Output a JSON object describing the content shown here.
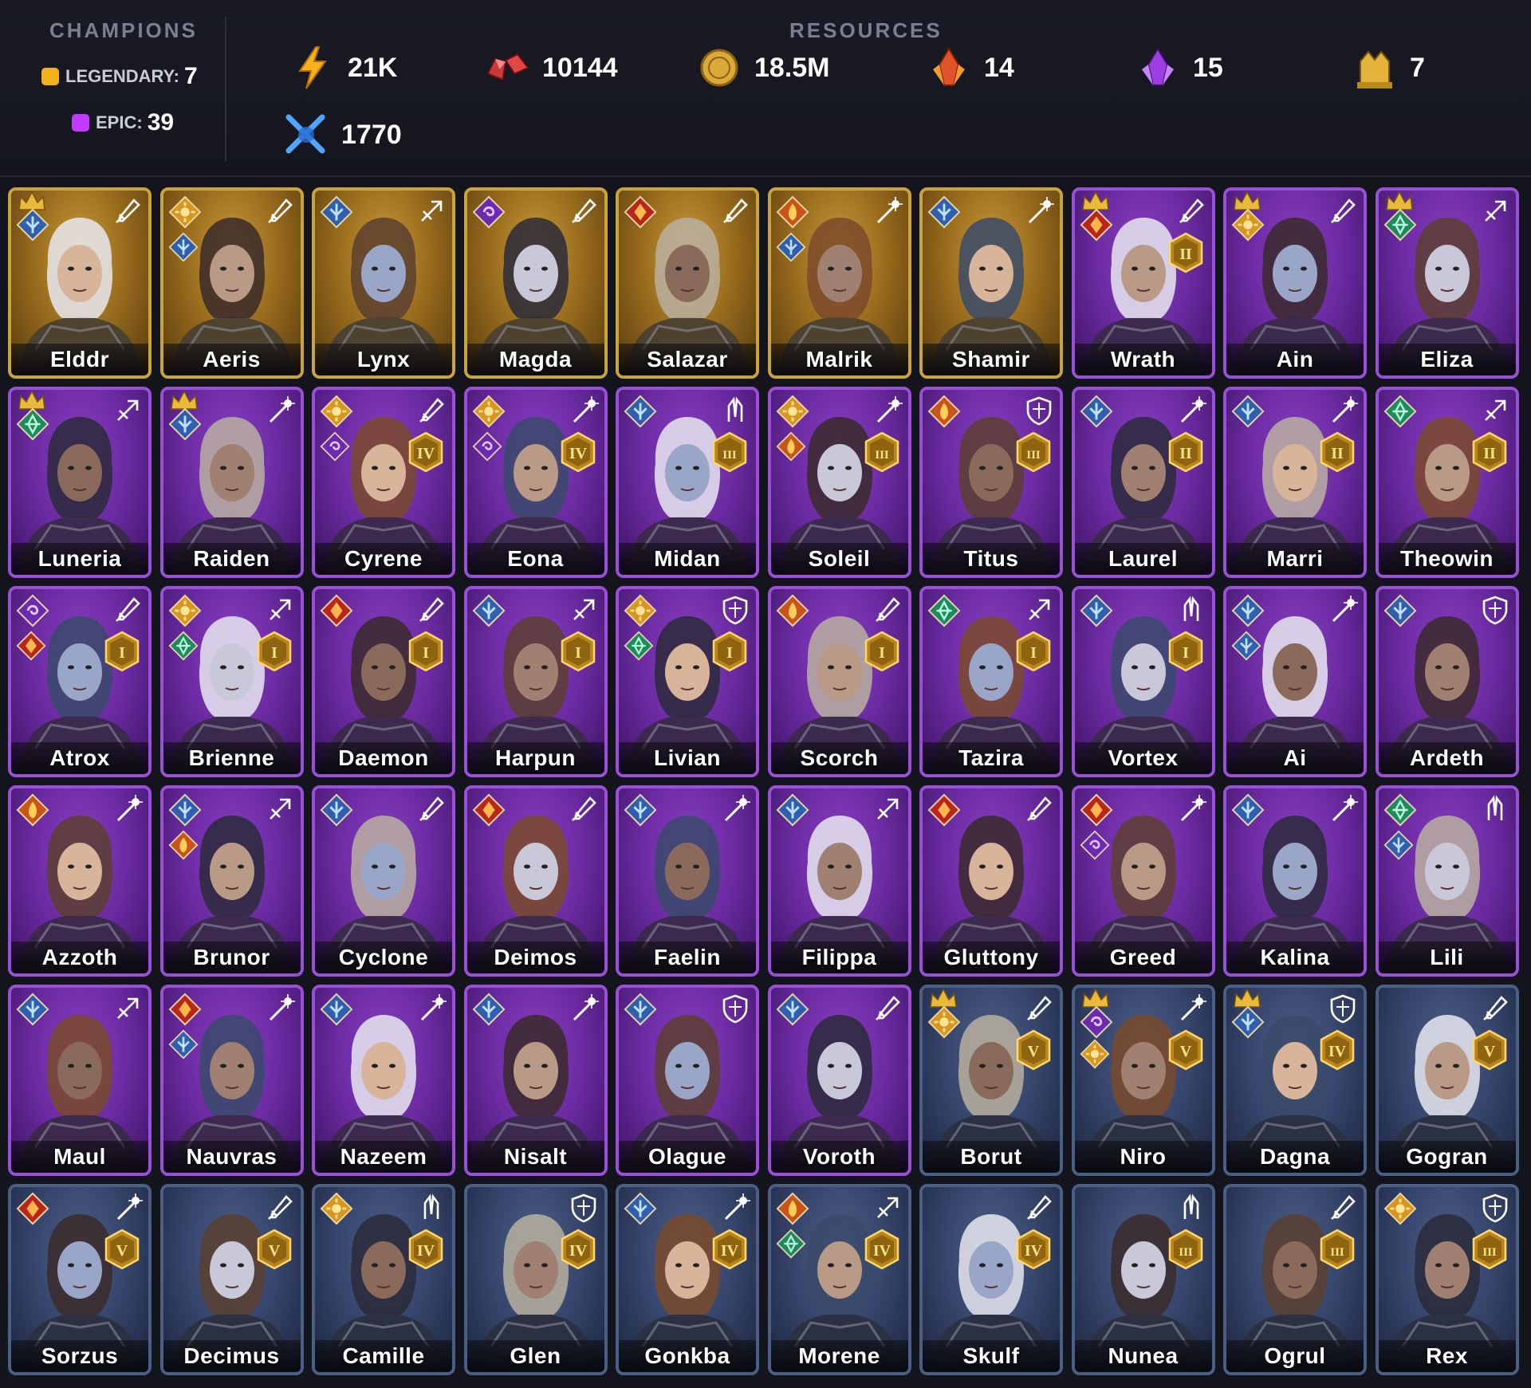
{
  "header": {
    "champions_title": "CHAMPIONS",
    "resources_title": "RESOURCES",
    "legendary_label": "LEGENDARY:",
    "legendary_count": "7",
    "epic_label": "EPIC:",
    "epic_count": "39",
    "resources": [
      {
        "name": "energy-icon",
        "value": "21K"
      },
      {
        "name": "gems-icon",
        "value": "10144"
      },
      {
        "name": "silver-coin-icon",
        "value": "18.5M"
      },
      {
        "name": "fire-crystal-icon",
        "value": "14"
      },
      {
        "name": "void-crystal-icon",
        "value": "15"
      },
      {
        "name": "gold-statue-icon",
        "value": "7"
      },
      {
        "name": "arena-swords-icon",
        "value": "1770"
      }
    ]
  },
  "colors": {
    "legendary": "#c9a43a",
    "epic": "#9a4fd8",
    "rare": "#4a5f85",
    "legendary_dot": "#f3b21b",
    "epic_dot": "#c23cff"
  },
  "champions": [
    {
      "name": "Elddr",
      "rarity": "legendary",
      "affinity": [
        "ice"
      ],
      "role": "sword",
      "crown": true,
      "rank": ""
    },
    {
      "name": "Aeris",
      "rarity": "legendary",
      "affinity": [
        "sun",
        "ice"
      ],
      "role": "sword",
      "crown": false,
      "rank": ""
    },
    {
      "name": "Lynx",
      "rarity": "legendary",
      "affinity": [
        "ice"
      ],
      "role": "crossbow",
      "crown": false,
      "rank": ""
    },
    {
      "name": "Magda",
      "rarity": "legendary",
      "affinity": [
        "void"
      ],
      "role": "sword",
      "crown": false,
      "rank": ""
    },
    {
      "name": "Salazar",
      "rarity": "legendary",
      "affinity": [
        "fire"
      ],
      "role": "sword",
      "crown": false,
      "rank": ""
    },
    {
      "name": "Malrik",
      "rarity": "legendary",
      "affinity": [
        "flame",
        "ice"
      ],
      "role": "staff",
      "crown": false,
      "rank": ""
    },
    {
      "name": "Shamir",
      "rarity": "legendary",
      "affinity": [
        "ice"
      ],
      "role": "staff",
      "crown": false,
      "rank": ""
    },
    {
      "name": "Wrath",
      "rarity": "epic",
      "affinity": [
        "fire"
      ],
      "role": "sword",
      "crown": true,
      "rank": "II"
    },
    {
      "name": "Ain",
      "rarity": "epic",
      "affinity": [
        "sun"
      ],
      "role": "sword",
      "crown": true,
      "rank": ""
    },
    {
      "name": "Eliza",
      "rarity": "epic",
      "affinity": [
        "nature"
      ],
      "role": "crossbow",
      "crown": true,
      "rank": ""
    },
    {
      "name": "Luneria",
      "rarity": "epic",
      "affinity": [
        "nature"
      ],
      "role": "crossbow",
      "crown": true,
      "rank": ""
    },
    {
      "name": "Raiden",
      "rarity": "epic",
      "affinity": [
        "ice"
      ],
      "role": "staff",
      "crown": true,
      "rank": ""
    },
    {
      "name": "Cyrene",
      "rarity": "epic",
      "affinity": [
        "sun",
        "void"
      ],
      "role": "sword",
      "crown": false,
      "rank": "IV"
    },
    {
      "name": "Eona",
      "rarity": "epic",
      "affinity": [
        "sun",
        "void"
      ],
      "role": "staff",
      "crown": false,
      "rank": "IV"
    },
    {
      "name": "Midan",
      "rarity": "epic",
      "affinity": [
        "ice"
      ],
      "role": "hands",
      "crown": false,
      "rank": "III"
    },
    {
      "name": "Soleil",
      "rarity": "epic",
      "affinity": [
        "sun",
        "flame"
      ],
      "role": "staff",
      "crown": false,
      "rank": "III"
    },
    {
      "name": "Titus",
      "rarity": "epic",
      "affinity": [
        "flame"
      ],
      "role": "shield",
      "crown": false,
      "rank": "III"
    },
    {
      "name": "Laurel",
      "rarity": "epic",
      "affinity": [
        "ice"
      ],
      "role": "staff",
      "crown": false,
      "rank": "II"
    },
    {
      "name": "Marri",
      "rarity": "epic",
      "affinity": [
        "ice"
      ],
      "role": "staff",
      "crown": false,
      "rank": "II"
    },
    {
      "name": "Theowin",
      "rarity": "epic",
      "affinity": [
        "nature"
      ],
      "role": "crossbow",
      "crown": false,
      "rank": "II"
    },
    {
      "name": "Atrox",
      "rarity": "epic",
      "affinity": [
        "void",
        "fire"
      ],
      "role": "sword",
      "crown": false,
      "rank": "I"
    },
    {
      "name": "Brienne",
      "rarity": "epic",
      "affinity": [
        "sun",
        "nature"
      ],
      "role": "crossbow",
      "crown": false,
      "rank": "I"
    },
    {
      "name": "Daemon",
      "rarity": "epic",
      "affinity": [
        "fire"
      ],
      "role": "sword",
      "crown": false,
      "rank": "I"
    },
    {
      "name": "Harpun",
      "rarity": "epic",
      "affinity": [
        "ice"
      ],
      "role": "crossbow",
      "crown": false,
      "rank": "I"
    },
    {
      "name": "Livian",
      "rarity": "epic",
      "affinity": [
        "sun",
        "nature"
      ],
      "role": "shield",
      "crown": false,
      "rank": "I"
    },
    {
      "name": "Scorch",
      "rarity": "epic",
      "affinity": [
        "flame"
      ],
      "role": "sword",
      "crown": false,
      "rank": "I"
    },
    {
      "name": "Tazira",
      "rarity": "epic",
      "affinity": [
        "nature"
      ],
      "role": "crossbow",
      "crown": false,
      "rank": "I"
    },
    {
      "name": "Vortex",
      "rarity": "epic",
      "affinity": [
        "ice"
      ],
      "role": "hands",
      "crown": false,
      "rank": "I"
    },
    {
      "name": "Ai",
      "rarity": "epic",
      "affinity": [
        "ice",
        "ice"
      ],
      "role": "staff",
      "crown": false,
      "rank": ""
    },
    {
      "name": "Ardeth",
      "rarity": "epic",
      "affinity": [
        "ice"
      ],
      "role": "shield",
      "crown": false,
      "rank": ""
    },
    {
      "name": "Azzoth",
      "rarity": "epic",
      "affinity": [
        "flame"
      ],
      "role": "staff",
      "crown": false,
      "rank": ""
    },
    {
      "name": "Brunor",
      "rarity": "epic",
      "affinity": [
        "ice",
        "flame"
      ],
      "role": "crossbow",
      "crown": false,
      "rank": ""
    },
    {
      "name": "Cyclone",
      "rarity": "epic",
      "affinity": [
        "ice"
      ],
      "role": "sword",
      "crown": false,
      "rank": ""
    },
    {
      "name": "Deimos",
      "rarity": "epic",
      "affinity": [
        "fire"
      ],
      "role": "sword",
      "crown": false,
      "rank": ""
    },
    {
      "name": "Faelin",
      "rarity": "epic",
      "affinity": [
        "ice"
      ],
      "role": "staff",
      "crown": false,
      "rank": ""
    },
    {
      "name": "Filippa",
      "rarity": "epic",
      "affinity": [
        "ice"
      ],
      "role": "crossbow",
      "crown": false,
      "rank": ""
    },
    {
      "name": "Gluttony",
      "rarity": "epic",
      "affinity": [
        "fire"
      ],
      "role": "sword",
      "crown": false,
      "rank": ""
    },
    {
      "name": "Greed",
      "rarity": "epic",
      "affinity": [
        "fire",
        "void"
      ],
      "role": "staff",
      "crown": false,
      "rank": ""
    },
    {
      "name": "Kalina",
      "rarity": "epic",
      "affinity": [
        "ice"
      ],
      "role": "staff",
      "crown": false,
      "rank": ""
    },
    {
      "name": "Lili",
      "rarity": "epic",
      "affinity": [
        "nature",
        "ice"
      ],
      "role": "hands",
      "crown": false,
      "rank": ""
    },
    {
      "name": "Maul",
      "rarity": "epic",
      "affinity": [
        "ice"
      ],
      "role": "crossbow",
      "crown": false,
      "rank": ""
    },
    {
      "name": "Nauvras",
      "rarity": "epic",
      "affinity": [
        "fire",
        "ice"
      ],
      "role": "staff",
      "crown": false,
      "rank": ""
    },
    {
      "name": "Nazeem",
      "rarity": "epic",
      "affinity": [
        "ice"
      ],
      "role": "staff",
      "crown": false,
      "rank": ""
    },
    {
      "name": "Nisalt",
      "rarity": "epic",
      "affinity": [
        "ice"
      ],
      "role": "staff",
      "crown": false,
      "rank": ""
    },
    {
      "name": "Olague",
      "rarity": "epic",
      "affinity": [
        "ice"
      ],
      "role": "shield",
      "crown": false,
      "rank": ""
    },
    {
      "name": "Voroth",
      "rarity": "epic",
      "affinity": [
        "ice"
      ],
      "role": "sword",
      "crown": false,
      "rank": ""
    },
    {
      "name": "Borut",
      "rarity": "rare",
      "affinity": [
        "sun"
      ],
      "role": "sword",
      "crown": true,
      "rank": "V"
    },
    {
      "name": "Niro",
      "rarity": "rare",
      "affinity": [
        "void",
        "sun"
      ],
      "role": "staff",
      "crown": true,
      "rank": "V"
    },
    {
      "name": "Dagna",
      "rarity": "rare",
      "affinity": [
        "ice"
      ],
      "role": "shield",
      "crown": true,
      "rank": "IV"
    },
    {
      "name": "Gogran",
      "rarity": "rare",
      "affinity": [],
      "role": "sword",
      "crown": false,
      "rank": "V"
    },
    {
      "name": "Sorzus",
      "rarity": "rare",
      "affinity": [
        "fire"
      ],
      "role": "staff",
      "crown": false,
      "rank": "V"
    },
    {
      "name": "Decimus",
      "rarity": "rare",
      "affinity": [],
      "role": "sword",
      "crown": false,
      "rank": "V"
    },
    {
      "name": "Camille",
      "rarity": "rare",
      "affinity": [
        "sun"
      ],
      "role": "hands",
      "crown": false,
      "rank": "IV"
    },
    {
      "name": "Glen",
      "rarity": "rare",
      "affinity": [],
      "role": "shield",
      "crown": false,
      "rank": "IV"
    },
    {
      "name": "Gonkba",
      "rarity": "rare",
      "affinity": [
        "ice"
      ],
      "role": "staff",
      "crown": false,
      "rank": "IV"
    },
    {
      "name": "Morene",
      "rarity": "rare",
      "affinity": [
        "flame",
        "nature"
      ],
      "role": "crossbow",
      "crown": false,
      "rank": "IV"
    },
    {
      "name": "Skulf",
      "rarity": "rare",
      "affinity": [],
      "role": "sword",
      "crown": false,
      "rank": "IV"
    },
    {
      "name": "Nunea",
      "rarity": "rare",
      "affinity": [],
      "role": "hands",
      "crown": false,
      "rank": "III"
    },
    {
      "name": "Ogrul",
      "rarity": "rare",
      "affinity": [],
      "role": "sword",
      "crown": false,
      "rank": "III"
    },
    {
      "name": "Rex",
      "rarity": "rare",
      "affinity": [
        "sun"
      ],
      "role": "shield",
      "crown": false,
      "rank": "III"
    }
  ]
}
